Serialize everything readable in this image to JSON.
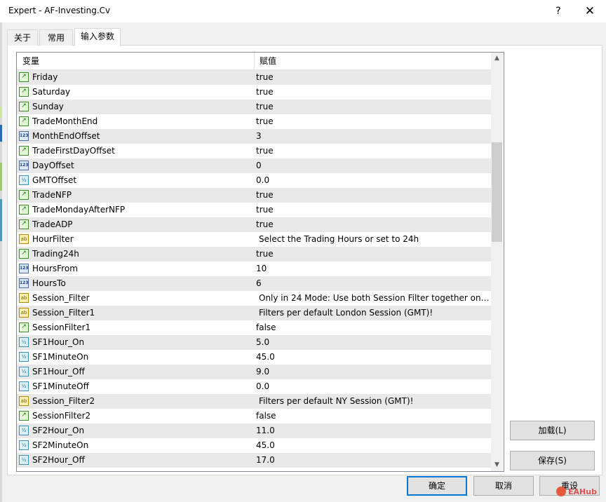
{
  "window": {
    "title": "Expert - AF-Investing.Cv",
    "help": "?",
    "close": "✕"
  },
  "tabs": [
    {
      "label": "关于"
    },
    {
      "label": "常用"
    },
    {
      "label": "输入参数"
    }
  ],
  "table": {
    "headers": {
      "variable": "变量",
      "value": "赋值"
    },
    "rows": [
      {
        "type": "bool",
        "name": "Friday",
        "value": "true"
      },
      {
        "type": "bool",
        "name": "Saturday",
        "value": "true"
      },
      {
        "type": "bool",
        "name": "Sunday",
        "value": "true"
      },
      {
        "type": "bool",
        "name": "TradeMonthEnd",
        "value": "true"
      },
      {
        "type": "int",
        "name": "MonthEndOffset",
        "value": "3"
      },
      {
        "type": "bool",
        "name": "TradeFirstDayOffset",
        "value": "true"
      },
      {
        "type": "int",
        "name": "DayOffset",
        "value": "0"
      },
      {
        "type": "double",
        "name": "GMTOffset",
        "value": "0.0"
      },
      {
        "type": "bool",
        "name": "TradeNFP",
        "value": "true"
      },
      {
        "type": "bool",
        "name": "TradeMondayAfterNFP",
        "value": "true"
      },
      {
        "type": "bool",
        "name": "TradeADP",
        "value": "true"
      },
      {
        "type": "string",
        "name": "HourFilter",
        "value": "Select the Trading Hours or set to 24h"
      },
      {
        "type": "bool",
        "name": "Trading24h",
        "value": "true"
      },
      {
        "type": "int",
        "name": "HoursFrom",
        "value": "10"
      },
      {
        "type": "int",
        "name": "HoursTo",
        "value": "6"
      },
      {
        "type": "string",
        "name": "Session_Filter",
        "value": "Only in 24 Mode: Use both Session Filter together onl..."
      },
      {
        "type": "string",
        "name": "Session_Filter1",
        "value": "Filters per default London Session (GMT)!"
      },
      {
        "type": "bool",
        "name": "SessionFilter1",
        "value": "false"
      },
      {
        "type": "double",
        "name": "SF1Hour_On",
        "value": "5.0"
      },
      {
        "type": "double",
        "name": "SF1MinuteOn",
        "value": "45.0"
      },
      {
        "type": "double",
        "name": "SF1Hour_Off",
        "value": "9.0"
      },
      {
        "type": "double",
        "name": "SF1MinuteOff",
        "value": "0.0"
      },
      {
        "type": "string",
        "name": "Session_Filter2",
        "value": "Filters per default NY Session (GMT)!"
      },
      {
        "type": "bool",
        "name": "SessionFilter2",
        "value": "false"
      },
      {
        "type": "double",
        "name": "SF2Hour_On",
        "value": "11.0"
      },
      {
        "type": "double",
        "name": "SF2MinuteOn",
        "value": "45.0"
      },
      {
        "type": "double",
        "name": "SF2Hour_Off",
        "value": "17.0"
      }
    ]
  },
  "icons": {
    "bool": {
      "glyph": "↗",
      "name": "boolean-icon"
    },
    "int": {
      "glyph": "123",
      "name": "integer-icon"
    },
    "double": {
      "glyph": "½",
      "name": "double-icon"
    },
    "string": {
      "glyph": "ab",
      "name": "string-icon"
    }
  },
  "scrollbar": {
    "up": "▲",
    "down": "▼"
  },
  "side_buttons": {
    "load": "加载(L)",
    "save": "保存(S)"
  },
  "bottom_buttons": {
    "ok": "确定",
    "cancel": "取消",
    "reset": "重设"
  },
  "watermark": {
    "text": "EAHub"
  }
}
